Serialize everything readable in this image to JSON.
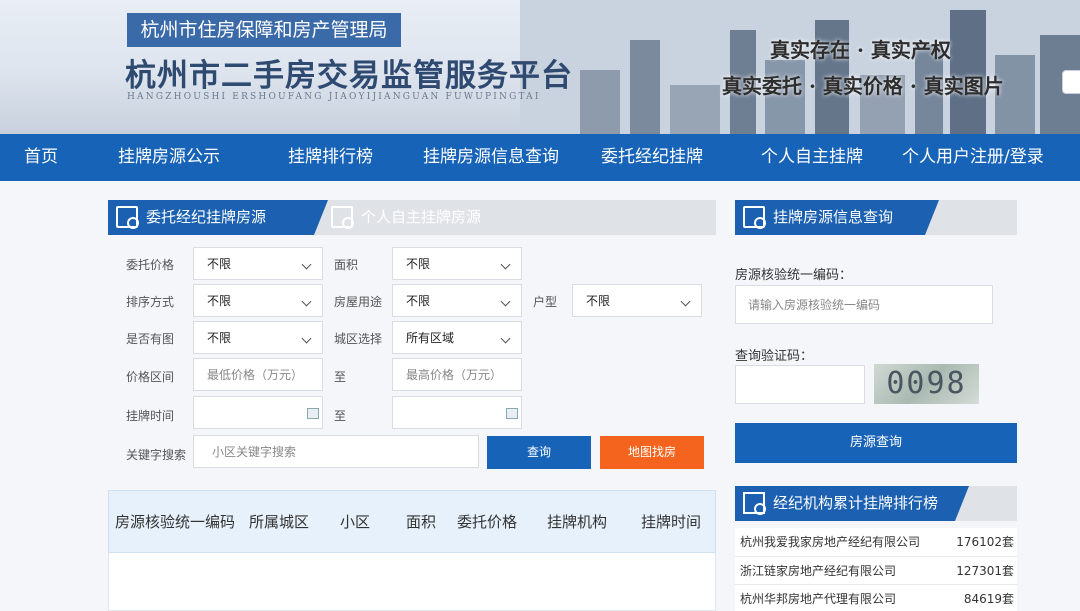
{
  "header": {
    "agency": "杭州市住房保障和房产管理局",
    "title": "杭州市二手房交易监管服务平台",
    "pinyin": "HANGZHOUSHI  ERSHOUFANG  JIAOYIJIANGUAN  FUWUPINGTAI",
    "slogan_line1": "真实存在 · 真实产权",
    "slogan_line2": "真实委托 · 真实价格 · 真实图片"
  },
  "nav": {
    "items": [
      "首页",
      "挂牌房源公示",
      "挂牌排行榜",
      "挂牌房源信息查询",
      "委托经纪挂牌",
      "个人自主挂牌",
      "个人用户注册/登录"
    ]
  },
  "search_panel": {
    "tab_active": "委托经纪挂牌房源",
    "tab_inactive": "个人自主挂牌房源",
    "fields": {
      "commission_price": {
        "label": "委托价格",
        "value": "不限"
      },
      "area": {
        "label": "面积",
        "value": "不限"
      },
      "sort": {
        "label": "排序方式",
        "value": "不限"
      },
      "usage": {
        "label": "房屋用途",
        "value": "不限"
      },
      "layout": {
        "label": "户型",
        "value": "不限"
      },
      "has_image": {
        "label": "是否有图",
        "value": "不限"
      },
      "district": {
        "label": "城区选择",
        "value": "所有区域"
      },
      "price_range": {
        "label": "价格区间",
        "min_placeholder": "最低价格（万元）",
        "to": "至",
        "max_placeholder": "最高价格（万元）"
      },
      "listing_time": {
        "label": "挂牌时间",
        "to": "至"
      },
      "keyword": {
        "label": "关键字搜索",
        "placeholder": "小区关键字搜索"
      }
    },
    "query_button": "查询",
    "map_button": "地图找房"
  },
  "table": {
    "headers": [
      "房源核验统一编码",
      "所属城区",
      "小区",
      "面积",
      "委托价格",
      "挂牌机构",
      "挂牌时间"
    ]
  },
  "right_panel": {
    "query_title": "挂牌房源信息查询",
    "code_label": "房源核验统一编码：",
    "code_placeholder": "请输入房源核验统一编码",
    "captcha_label": "查询验证码：",
    "captcha_value": "0098",
    "query_button": "房源查询",
    "rank_title": "经纪机构累计挂牌排行榜",
    "ranks": [
      {
        "name": "杭州我爱我家房地产经纪有限公司",
        "count": "176102套"
      },
      {
        "name": "浙江链家房地产经纪有限公司",
        "count": "127301套"
      },
      {
        "name": "杭州华邦房地产代理有限公司",
        "count": "84619套"
      }
    ]
  },
  "colors": {
    "primary": "#1763b8",
    "accent_orange": "#f5641e",
    "tab_gray": "#dfe2e7"
  }
}
